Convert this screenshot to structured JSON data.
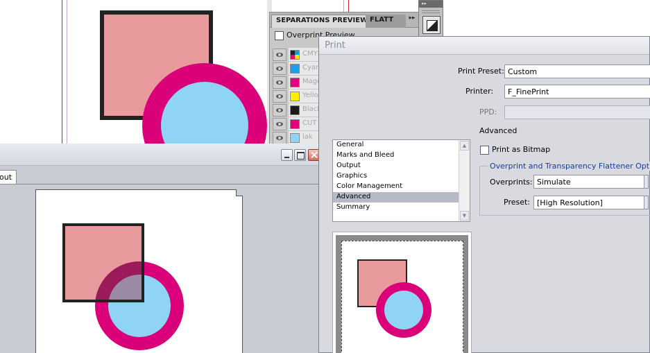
{
  "separations_panel": {
    "tabs": [
      "SEPARATIONS PREVIEW",
      "FLATT"
    ],
    "overprint_label": "Overprint Preview",
    "rows": [
      {
        "name": "CMYK",
        "color": "#3a7fd0"
      },
      {
        "name": "Cyan",
        "color": "#1ea0e6"
      },
      {
        "name": "Magenta",
        "color": "#e3007d"
      },
      {
        "name": "Yellow",
        "color": "#ffee00"
      },
      {
        "name": "Black",
        "color": "#1a1a1a"
      },
      {
        "name": "CUT",
        "color": "#e3007d"
      },
      {
        "name": "lak",
        "color": "#8fd3f5"
      }
    ]
  },
  "document_window": {
    "tab_label": "out"
  },
  "artwork": {
    "square_fill": "#e89a9c",
    "square_stroke": "#222222",
    "ring_color": "#d9007a",
    "circle_fill": "#8fd3f5"
  },
  "print_dialog": {
    "title": "Print",
    "print_preset_label": "Print Preset:",
    "print_preset_value": "Custom",
    "printer_label": "Printer:",
    "printer_value": "F_FinePrint",
    "ppd_label": "PPD:",
    "section_title": "Advanced",
    "categories": [
      "General",
      "Marks and Bleed",
      "Output",
      "Graphics",
      "Color Management",
      "Advanced",
      "Summary"
    ],
    "selected_category": "Advanced",
    "print_as_bitmap_label": "Print as Bitmap",
    "group_title": "Overprint and Transparency Flattener Options",
    "overprints_label": "Overprints:",
    "overprints_value": "Simulate",
    "preset_label": "Preset:",
    "preset_value": "[High Resolution]"
  }
}
